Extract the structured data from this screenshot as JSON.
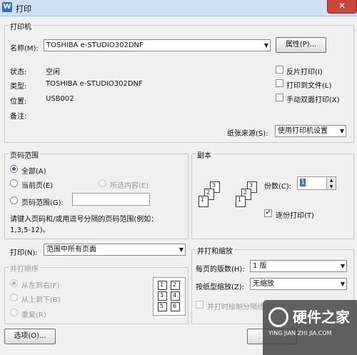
{
  "window": {
    "title": "打印",
    "app_icon": "W",
    "close": "✕"
  },
  "printer": {
    "group_label": "打印机",
    "name_label": "名称(M):",
    "name_value": "TOSHIBA e-STUDIO302DNF",
    "properties_button": "属性(P)...",
    "status_label": "状态:",
    "status_value": "空闲",
    "type_label": "类型:",
    "type_value": "TOSHIBA e-STUDIO302DNF",
    "location_label": "位置:",
    "location_value": "USB002",
    "comment_label": "备注:",
    "options": [
      {
        "label": "反片打印(I)",
        "checked": false
      },
      {
        "label": "打印到文件(L)",
        "checked": false
      },
      {
        "label": "手动双面打印(X)",
        "checked": false
      }
    ],
    "paper_source_label": "纸张来源(S):",
    "paper_source_value": "使用打印机设置"
  },
  "page_range": {
    "group_label": "页码范围",
    "all": "全部(A)",
    "current": "当前页(E)",
    "selection": "所选内容(E)",
    "pages": "页码范围(G):",
    "hint_line1": "请键入页码和/或用逗号分隔的页码范围(例如：",
    "hint_line2": "1,3,5-12)。"
  },
  "copies": {
    "group_label": "副本",
    "count_label": "份数(C):",
    "count_value": "1",
    "collate_label": "逐份打印(T)",
    "collate_checked": true
  },
  "print_what": {
    "label": "打印(N):",
    "value": "范围中所有页面",
    "order_group_label": "并打顺序",
    "order_options": [
      "从左到右(F)",
      "从上到下(B)",
      "重复(R)"
    ],
    "preview_numbers": [
      "1",
      "2",
      "3",
      "4",
      "5",
      "6"
    ]
  },
  "zoom": {
    "group_label": "并打和缩放",
    "per_sheet_label": "每页的版数(H):",
    "per_sheet_value": "1 版",
    "scale_label": "按纸型缩放(Z):",
    "scale_value": "无缩放",
    "draw_border_label": "并打时绘制分隔线(D)"
  },
  "footer": {
    "options_button": "选项(O)..."
  },
  "watermark": {
    "line1": "硬件之家",
    "line2": "YING JIAN ZHI JIA.COM"
  }
}
